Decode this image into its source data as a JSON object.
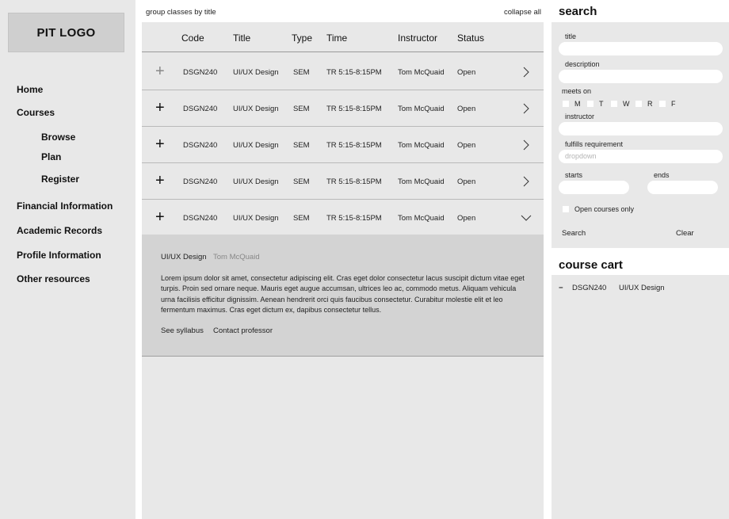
{
  "sidebar": {
    "logo": "PIT LOGO",
    "nav": {
      "home": "Home",
      "courses": "Courses",
      "browse": "Browse",
      "plan": "Plan",
      "register": "Register",
      "financial": "Financial Information",
      "academic": "Academic Records",
      "profile": "Profile Information",
      "other": "Other resources"
    }
  },
  "main": {
    "group_label": "group classes by title",
    "collapse_label": "collapse all",
    "headers": {
      "code": "Code",
      "title": "Title",
      "type": "Type",
      "time": "Time",
      "instructor": "Instructor",
      "status": "Status"
    },
    "rows": [
      {
        "code": "DSGN240",
        "title": "UI/UX Design",
        "type": "SEM",
        "time": "TR 5:15-8:15PM",
        "instructor": "Tom McQuaid",
        "status": "Open"
      },
      {
        "code": "DSGN240",
        "title": "UI/UX Design",
        "type": "SEM",
        "time": "TR 5:15-8:15PM",
        "instructor": "Tom McQuaid",
        "status": "Open"
      },
      {
        "code": "DSGN240",
        "title": "UI/UX Design",
        "type": "SEM",
        "time": "TR 5:15-8:15PM",
        "instructor": "Tom McQuaid",
        "status": "Open"
      },
      {
        "code": "DSGN240",
        "title": "UI/UX Design",
        "type": "SEM",
        "time": "TR 5:15-8:15PM",
        "instructor": "Tom McQuaid",
        "status": "Open"
      },
      {
        "code": "DSGN240",
        "title": "UI/UX Design",
        "type": "SEM",
        "time": "TR 5:15-8:15PM",
        "instructor": "Tom McQuaid",
        "status": "Open"
      }
    ],
    "detail": {
      "title": "UI/UX Design",
      "professor": "Tom McQuaid",
      "description": "Lorem ipsum dolor sit amet, consectetur adipiscing elit. Cras eget dolor consectetur lacus suscipit dictum vitae eget turpis. Proin sed ornare neque. Mauris eget augue accumsan, ultrices leo ac, commodo metus. Aliquam vehicula urna facilisis efficitur dignissim. Aenean hendrerit orci quis faucibus consectetur. Curabitur molestie elit et leo fermentum maximus. Cras eget dictum ex, dapibus consectetur tellus.",
      "syllabus_link": "See syllabus",
      "contact_link": "Contact professor"
    }
  },
  "search": {
    "heading": "search",
    "title_label": "title",
    "description_label": "description",
    "meets_on_label": "meets on",
    "days": [
      "M",
      "T",
      "W",
      "R",
      "F"
    ],
    "instructor_label": "instructor",
    "fulfills_label": "fulfills requirement",
    "fulfills_placeholder": "dropdown",
    "starts_label": "starts",
    "ends_label": "ends",
    "open_only_label": "Open courses only",
    "search_button": "Search",
    "clear_button": "Clear"
  },
  "cart": {
    "heading": "course cart",
    "items": [
      {
        "code": "DSGN240",
        "title": "UI/UX Design"
      }
    ]
  }
}
